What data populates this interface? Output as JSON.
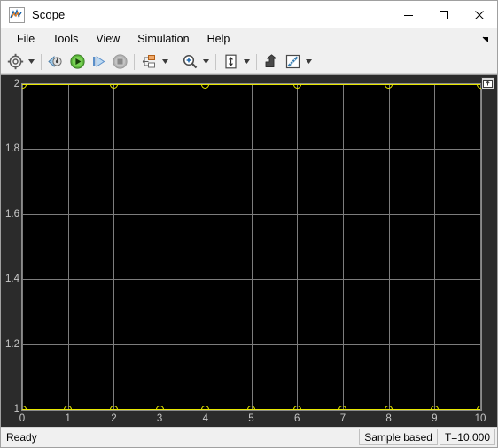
{
  "window": {
    "title": "Scope",
    "app_icon": "scope-app-icon",
    "controls": [
      {
        "name": "minimize-button",
        "glyph": "minimize-icon"
      },
      {
        "name": "maximize-button",
        "glyph": "maximize-icon"
      },
      {
        "name": "close-button",
        "glyph": "close-icon"
      }
    ]
  },
  "menubar": {
    "items": [
      {
        "label": "File"
      },
      {
        "label": "Tools"
      },
      {
        "label": "View"
      },
      {
        "label": "Simulation"
      },
      {
        "label": "Help"
      }
    ],
    "overflow_icon": "menu-overflow-icon"
  },
  "toolbar": {
    "buttons": [
      {
        "name": "configuration-properties-button",
        "icon": "gear-icon",
        "has_dropdown": true,
        "enabled": true
      },
      {
        "name": "run-to-time-button",
        "icon": "run-to-time-icon",
        "has_dropdown": false,
        "enabled": true
      },
      {
        "name": "run-button",
        "icon": "play-icon",
        "has_dropdown": false,
        "enabled": true
      },
      {
        "name": "step-forward-button",
        "icon": "step-forward-icon",
        "has_dropdown": false,
        "enabled": true
      },
      {
        "name": "stop-button",
        "icon": "stop-icon",
        "has_dropdown": false,
        "enabled": false
      },
      {
        "name": "signal-selection-button",
        "icon": "signal-selector-icon",
        "has_dropdown": true,
        "enabled": true
      },
      {
        "name": "zoom-in-button",
        "icon": "zoom-in-icon",
        "has_dropdown": true,
        "enabled": true
      },
      {
        "name": "autoscale-button",
        "icon": "autoscale-icon",
        "has_dropdown": true,
        "enabled": true
      },
      {
        "name": "cursor-measurements-button",
        "icon": "cursor-measurements-icon",
        "has_dropdown": false,
        "enabled": true
      },
      {
        "name": "measurements-button",
        "icon": "ruler-icon",
        "has_dropdown": true,
        "enabled": true
      }
    ]
  },
  "plot": {
    "dock_icon": "undock-icon",
    "background": "#000000",
    "grid_color": "#7d7d7d",
    "trace_color": "#e8e800",
    "panel_background": "#2b2b2b"
  },
  "statusbar": {
    "ready_label": "Ready",
    "fields": [
      {
        "name": "sampling-mode-field",
        "label": "Sample based"
      },
      {
        "name": "simulation-time-field",
        "label": "T=10.000"
      }
    ]
  },
  "chart_data": {
    "type": "scatter",
    "title": "",
    "xlabel": "",
    "ylabel": "",
    "xlim": [
      0,
      10
    ],
    "ylim": [
      1,
      2
    ],
    "grid": true,
    "legend": false,
    "xticks": [
      0,
      1,
      2,
      3,
      4,
      5,
      6,
      7,
      8,
      9,
      10
    ],
    "xtick_labels": [
      "0",
      "1",
      "2",
      "3",
      "4",
      "5",
      "6",
      "7",
      "8",
      "9",
      "10"
    ],
    "yticks": [
      1,
      1.2,
      1.4,
      1.6,
      1.8,
      2
    ],
    "ytick_labels": [
      "1",
      "1.2",
      "1.4",
      "1.6",
      "1.8",
      "2"
    ],
    "marker": "circle-open",
    "color": "#e8e800",
    "series": [
      {
        "name": "signal-upper",
        "x": [
          0,
          2,
          4,
          6,
          8,
          10
        ],
        "y": [
          2,
          2,
          2,
          2,
          2,
          2
        ]
      },
      {
        "name": "signal-lower",
        "x": [
          0,
          1,
          2,
          3,
          4,
          5,
          6,
          7,
          8,
          9,
          10
        ],
        "y": [
          1,
          1,
          1,
          1,
          1,
          1,
          1,
          1,
          1,
          1,
          1
        ]
      }
    ]
  }
}
